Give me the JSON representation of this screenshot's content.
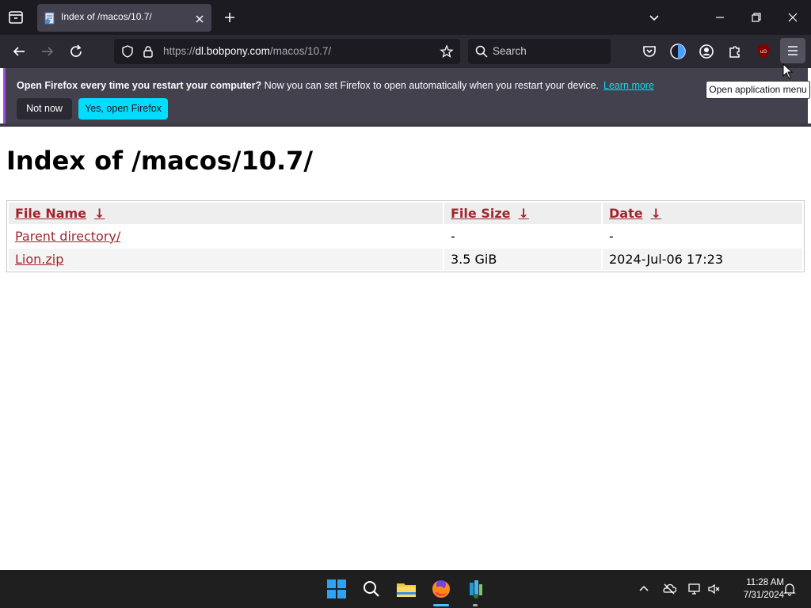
{
  "browser": {
    "tab": {
      "title": "Index of /macos/10.7/"
    },
    "url": {
      "scheme": "https://",
      "host": "dl.bobpony.com",
      "path": "/macos/10.7/"
    },
    "search": {
      "placeholder": "Search"
    },
    "tooltip": "Open application menu"
  },
  "infobar": {
    "bold_text": "Open Firefox every time you restart your computer?",
    "text": " Now you can set Firefox to open automatically when you restart your device.",
    "link": "Learn more",
    "not_now": "Not now",
    "yes_open": "Yes, open Firefox"
  },
  "page": {
    "heading": "Index of /macos/10.7/",
    "columns": [
      "File Name",
      "File Size",
      "Date"
    ],
    "sort_arrow": "↓",
    "rows": [
      {
        "name": "Parent directory/",
        "size": "-",
        "date": "-"
      },
      {
        "name": "Lion.zip",
        "size": "3.5 GiB",
        "date": "2024-Jul-06 17:23"
      }
    ]
  },
  "taskbar": {
    "time": "11:28 AM",
    "date": "7/31/2024"
  },
  "colors": {
    "accent": "#00ddff",
    "link": "#a0262e",
    "chrome_dark": "#1c1b22"
  }
}
